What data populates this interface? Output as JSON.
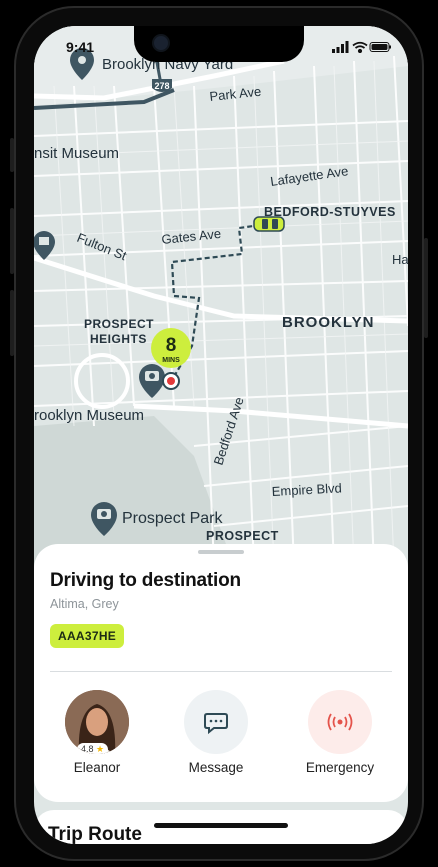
{
  "status": {
    "time": "9:41"
  },
  "map": {
    "labels": {
      "navy_yard": "Brooklyn Navy Yard",
      "route_shield": "278",
      "park_ave": "Park Ave",
      "transit_museum": "nsit Museum",
      "lafayette": "Lafayette Ave",
      "bedstuy": "BEDFORD-STUYVES",
      "fulton": "Fulton St",
      "gates": "Gates Ave",
      "ha": "Ha",
      "prospect_heights_1": "PROSPECT",
      "prospect_heights_2": "HEIGHTS",
      "brooklyn": "BROOKLYN",
      "brooklyn_museum": "rooklyn Museum",
      "bedford_ave": "Bedford Ave",
      "empire": "Empire Blvd",
      "prospect_park": "Prospect Park",
      "prospect_bottom": "PROSPECT"
    },
    "eta": {
      "value": "8",
      "unit": "MINS"
    }
  },
  "sheet": {
    "title": "Driving to destination",
    "subtitle": "Altima, Grey",
    "plate": "AAA37HE",
    "driver": {
      "name": "Eleanor",
      "rating": "4.8"
    },
    "message_label": "Message",
    "emergency_label": "Emergency"
  },
  "trip": {
    "title": "Trip Route"
  },
  "colors": {
    "accent": "#cdee3d",
    "emergency": "#e4534b",
    "map_bg": "#dfe6e5"
  }
}
